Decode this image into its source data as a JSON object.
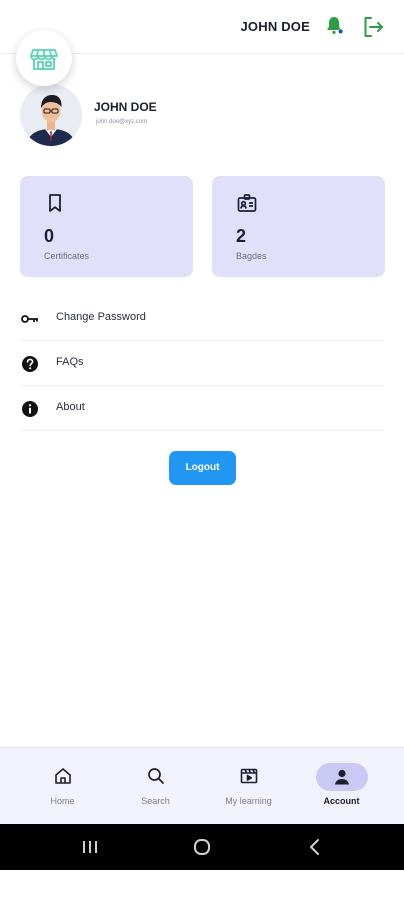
{
  "header": {
    "user_name": "JOHN DOE",
    "store_icon": "storefront-icon",
    "notification_icon": "bell-icon",
    "logout_icon": "logout-icon",
    "accent_green": "#2e9e46"
  },
  "profile": {
    "name": "JOHN DOE",
    "email": "john.doe@xyz.com",
    "avatar_icon": "avatar-businessman"
  },
  "stats": [
    {
      "icon": "bookmark-icon",
      "value": "0",
      "label": "Certificates"
    },
    {
      "icon": "id-badge-icon",
      "value": "2",
      "label": "Bagdes"
    }
  ],
  "menu": [
    {
      "icon": "key-icon",
      "label": "Change Password"
    },
    {
      "icon": "question-circle-icon",
      "label": "FAQs"
    },
    {
      "icon": "info-circle-icon",
      "label": "About"
    }
  ],
  "logout_button": {
    "label": "Logout",
    "color": "#2196f3"
  },
  "bottom_nav": {
    "active": "Account",
    "items": [
      {
        "icon": "home-icon",
        "label": "Home"
      },
      {
        "icon": "search-icon",
        "label": "Search"
      },
      {
        "icon": "video-clapper-icon",
        "label": "My learning"
      },
      {
        "icon": "person-icon",
        "label": "Account"
      }
    ]
  },
  "system_nav": [
    "recent-apps-icon",
    "home-circle-icon",
    "back-chevron-icon"
  ]
}
